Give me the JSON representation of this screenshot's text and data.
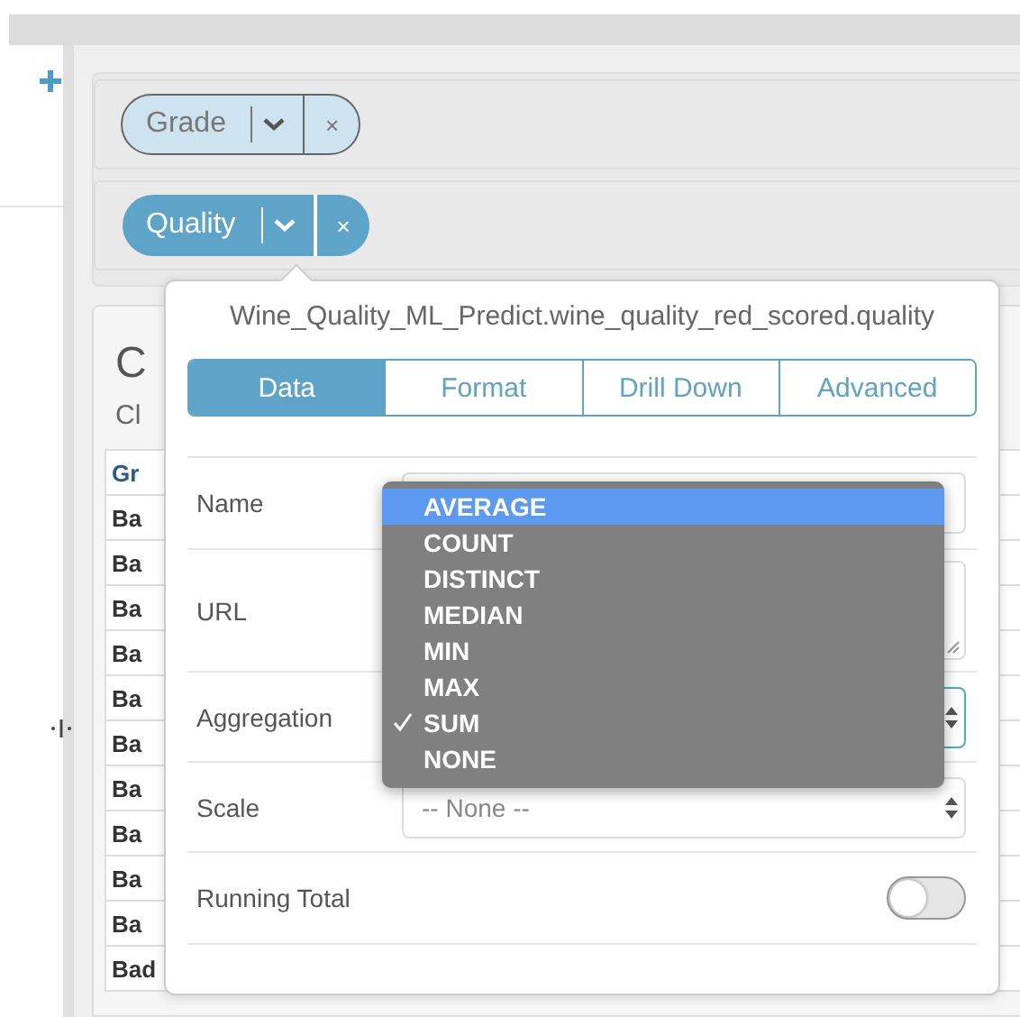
{
  "filters": [
    {
      "label": "Grade",
      "selected": false,
      "remove": "×"
    },
    {
      "label": "Quality",
      "selected": true,
      "remove": "×"
    }
  ],
  "card": {
    "title": "C",
    "subtitle": "Cl"
  },
  "table": {
    "header": "Gr",
    "rows": [
      "Ba",
      "Ba",
      "Ba",
      "Ba",
      "Ba",
      "Ba",
      "Ba",
      "Ba",
      "Ba",
      "Ba",
      "Bad"
    ]
  },
  "popover": {
    "title": "Wine_Quality_ML_Predict.wine_quality_red_scored.quality",
    "tabs": [
      {
        "label": "Data",
        "selected": true
      },
      {
        "label": "Format",
        "selected": false
      },
      {
        "label": "Drill Down",
        "selected": false
      },
      {
        "label": "Advanced",
        "selected": false
      }
    ],
    "fields": [
      {
        "kind": "text",
        "label": "Name",
        "focused": false
      },
      {
        "kind": "textarea",
        "label": "URL",
        "focused": false
      },
      {
        "kind": "select",
        "label": "Aggregation",
        "focused": true
      },
      {
        "kind": "select",
        "label": "Scale",
        "value": "-- None --",
        "focused": false
      },
      {
        "kind": "toggle",
        "label": "Running Total",
        "on": false
      }
    ]
  },
  "dropdown": {
    "options": [
      {
        "label": "AVERAGE",
        "highlighted": true,
        "checked": false
      },
      {
        "label": "COUNT",
        "highlighted": false,
        "checked": false
      },
      {
        "label": "DISTINCT",
        "highlighted": false,
        "checked": false
      },
      {
        "label": "MEDIAN",
        "highlighted": false,
        "checked": false
      },
      {
        "label": "MIN",
        "highlighted": false,
        "checked": false
      },
      {
        "label": "MAX",
        "highlighted": false,
        "checked": false
      },
      {
        "label": "SUM",
        "highlighted": false,
        "checked": true
      },
      {
        "label": "NONE",
        "highlighted": false,
        "checked": false
      }
    ]
  }
}
